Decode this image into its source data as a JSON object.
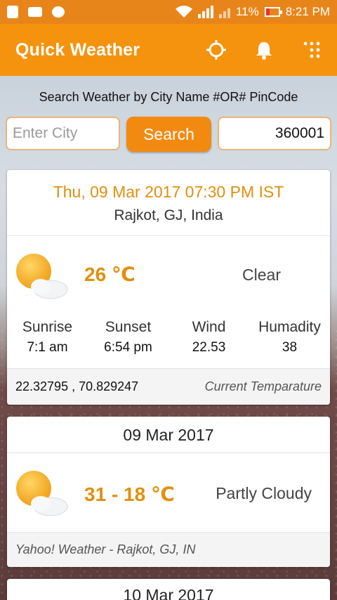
{
  "status_bar": {
    "battery": "11%",
    "time": "8:21 PM"
  },
  "app_bar": {
    "title": "Quick Weather"
  },
  "search": {
    "caption": "Search Weather by City Name #OR# PinCode",
    "city_placeholder": "Enter City",
    "button_label": "Search",
    "pincode_value": "360001"
  },
  "current": {
    "datetime": "Thu, 09 Mar 2017 07:30 PM IST",
    "location": "Rajkot,  GJ, India",
    "temperature": "26 ℃",
    "condition": "Clear",
    "stats": [
      {
        "label": "Sunrise",
        "value": "7:1 am"
      },
      {
        "label": "Sunset",
        "value": "6:54 pm"
      },
      {
        "label": "Wind",
        "value": "22.53"
      },
      {
        "label": "Humadity",
        "value": "38"
      }
    ],
    "coordinates": "22.32795 , 70.829247",
    "footer_label": "Current Temparature"
  },
  "forecast": [
    {
      "date": "09 Mar 2017",
      "temperature": "31 - 18 ℃",
      "condition": "Partly Cloudy",
      "source": "Yahoo! Weather - Rajkot, GJ, IN"
    },
    {
      "date": "10 Mar 2017"
    }
  ],
  "icons": {
    "weather": "partly-cloudy-icon",
    "location": "gps-icon",
    "notifications": "bell-icon",
    "menu": "dots-grid-icon"
  },
  "colors": {
    "app_bar": "#f5930e",
    "status_bar": "#e8851a",
    "accent_text": "#e0900f",
    "button": "#f28a12"
  }
}
